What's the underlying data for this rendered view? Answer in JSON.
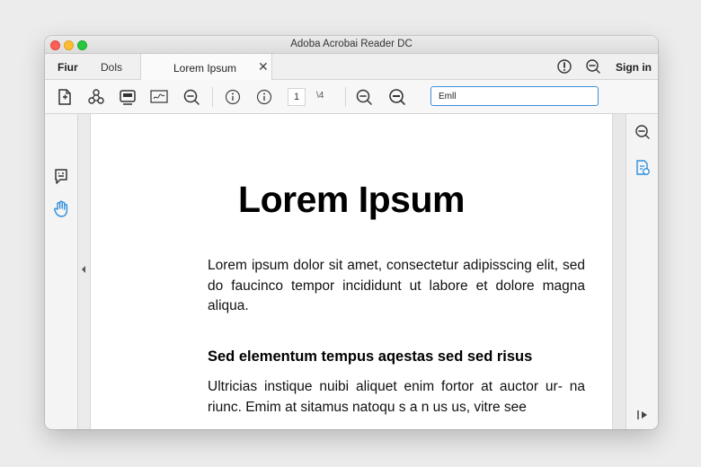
{
  "window": {
    "title": "Adoba Acrobai Reader DC"
  },
  "tabs": {
    "home": "Fiur",
    "tools": "Dols",
    "document": "Lorem Ipsum",
    "close": "✕"
  },
  "header": {
    "sign_in": "Sign in"
  },
  "toolbar": {
    "page_number": "1",
    "page_count": "\\4",
    "search_value": "Emll"
  },
  "document": {
    "title": "Lorem Ipsum",
    "paragraph1": "Lorem ipsum dolor sit amet, consectetur adipisscing elit, sed do faucinco tempor incididunt ut labore et dolore magna aliqua.",
    "heading": "Sed elementum tempus aqestas sed sed risus",
    "paragraph2": "Ultricias instique nuibi aliquet enim fortor at auctor ur- na riunc. Emim at sitamus natoqu s a n us us, vitre see"
  },
  "icons": {
    "accent": "#2f8fde",
    "toolbar": [
      "create-pdf-icon",
      "share-icon",
      "print-icon",
      "sign-icon",
      "zoom-out-icon",
      "info-icon",
      "info-icon",
      "zoom-out-icon",
      "zoom-fit-icon"
    ],
    "left_rail": [
      "comment-icon",
      "hand-tool-icon"
    ],
    "right_rail": [
      "search-zoom-icon",
      "export-pdf-icon",
      "collapse-panel-icon"
    ]
  }
}
